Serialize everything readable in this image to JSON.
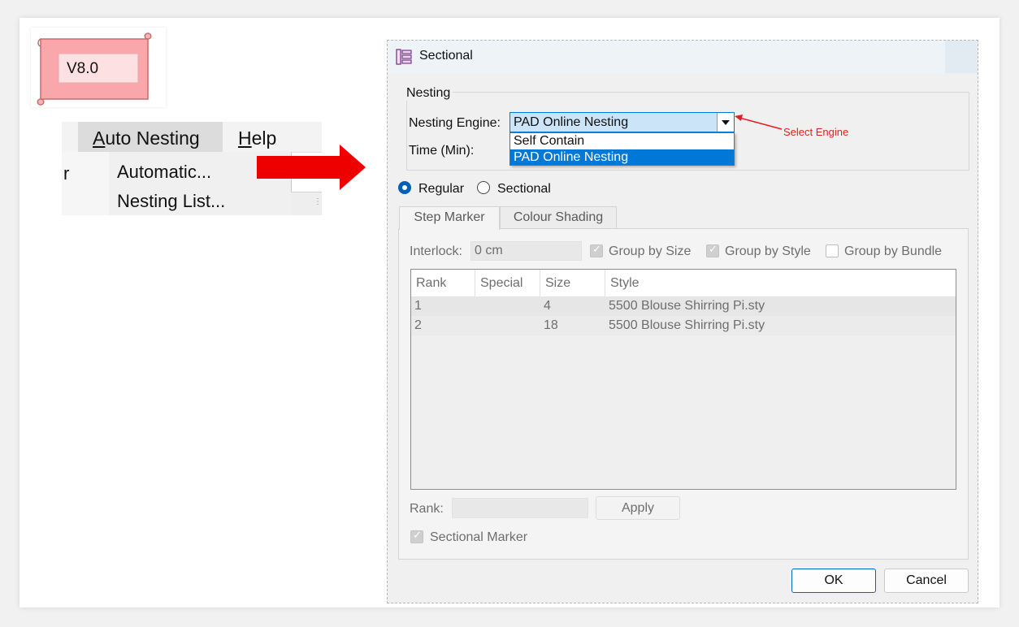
{
  "badge": {
    "version": "V8.0"
  },
  "menu": {
    "menubar": {
      "auto_nesting": "Auto Nesting",
      "help": "Help"
    },
    "left_stub": "r",
    "dropdown": [
      "Automatic...",
      "Nesting List..."
    ]
  },
  "dialog": {
    "title": "Sectional",
    "nesting_group": {
      "label": "Nesting",
      "engine_label": "Nesting Engine:",
      "engine_value": "PAD Online Nesting",
      "engine_options": [
        "Self Contain",
        "PAD Online Nesting"
      ],
      "time_label": "Time (Min):"
    },
    "annotation": "Select Engine",
    "mode": {
      "regular": "Regular",
      "sectional": "Sectional",
      "selected": "Regular"
    },
    "tabs": [
      "Step Marker",
      "Colour Shading"
    ],
    "step_marker": {
      "interlock_label": "Interlock:",
      "interlock_value": "0 cm",
      "group_by_size": "Group by Size",
      "group_by_style": "Group by Style",
      "group_by_bundle": "Group by Bundle",
      "columns": [
        "Rank",
        "Special",
        "Size",
        "Style"
      ],
      "rows": [
        {
          "rank": "1",
          "special": "",
          "size": "4",
          "style": "5500 Blouse Shirring Pi.sty"
        },
        {
          "rank": "2",
          "special": "",
          "size": "18",
          "style": "5500 Blouse Shirring Pi.sty"
        }
      ],
      "rank_label": "Rank:",
      "rank_value": "",
      "apply": "Apply",
      "sectional_marker": "Sectional Marker"
    },
    "ok": "OK",
    "cancel": "Cancel"
  },
  "colors": {
    "accent": "#0078d7",
    "annotation": "#e02020",
    "badge": "#f7a8aa"
  }
}
